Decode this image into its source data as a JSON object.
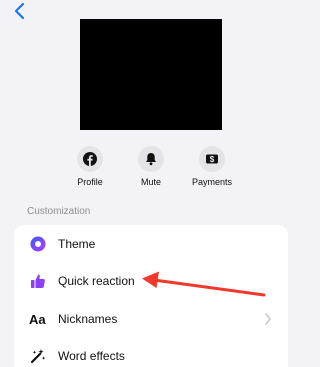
{
  "header": {
    "back_icon": "chevron-left-icon"
  },
  "avatar": {
    "color": "#000000"
  },
  "actions": [
    {
      "label": "Profile",
      "icon": "facebook-icon"
    },
    {
      "label": "Mute",
      "icon": "bell-icon"
    },
    {
      "label": "Payments",
      "icon": "dollar-icon"
    }
  ],
  "customization": {
    "title": "Customization",
    "items": [
      {
        "label": "Theme",
        "icon": "theme-circle-icon"
      },
      {
        "label": "Quick reaction",
        "icon": "thumbs-up-icon"
      },
      {
        "label": "Nicknames",
        "icon": "aa-text-icon"
      },
      {
        "label": "Word effects",
        "icon": "sparkle-wand-icon"
      }
    ]
  },
  "colors": {
    "accent": "#1877f2",
    "purple": "#8a3ffc",
    "arrow": "#f0392b"
  }
}
